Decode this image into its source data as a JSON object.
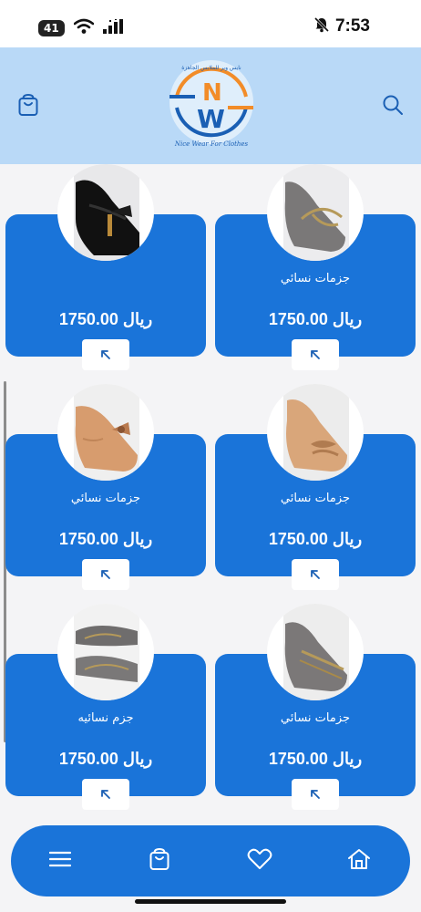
{
  "status_bar": {
    "carrier_badge": "41",
    "time": "7:53",
    "icons": [
      "carrier-badge",
      "wifi-icon",
      "signal-icon",
      "bell-muted-icon"
    ]
  },
  "header": {
    "background": "#b9d9f7",
    "logo": {
      "letters": "NW",
      "arabic_text": "نايس وير للملابس الجاهزة",
      "english_text": "Nice Wear For Clothes",
      "colors": {
        "blue": "#1a5fb4",
        "orange": "#f28c28"
      }
    },
    "left_icon": "cart-icon",
    "right_icon": "search-icon"
  },
  "theme": {
    "primary": "#1a74d9",
    "card_text": "#ffffff"
  },
  "products": [
    {
      "name": "",
      "price": "1750.00 ريال",
      "image": "black-shoe-with-bow"
    },
    {
      "name": "جزمات نسائي",
      "price": "1750.00 ريال",
      "image": "gray-flat-with-bow"
    },
    {
      "name": "جزمات نسائي",
      "price": "1750.00 ريال",
      "image": "tan-flat-with-bow"
    },
    {
      "name": "جزمات نسائي",
      "price": "1750.00 ريال",
      "image": "beige-flat-with-bow"
    },
    {
      "name": "جزم نسائيه",
      "price": "1750.00 ريال",
      "image": "gray-flats-pair"
    },
    {
      "name": "جزمات نسائي",
      "price": "1750.00 ريال",
      "image": "gray-flat-with-strap"
    }
  ],
  "bottom_nav": {
    "items": [
      "menu-icon",
      "cart-icon",
      "heart-icon",
      "home-icon"
    ]
  }
}
